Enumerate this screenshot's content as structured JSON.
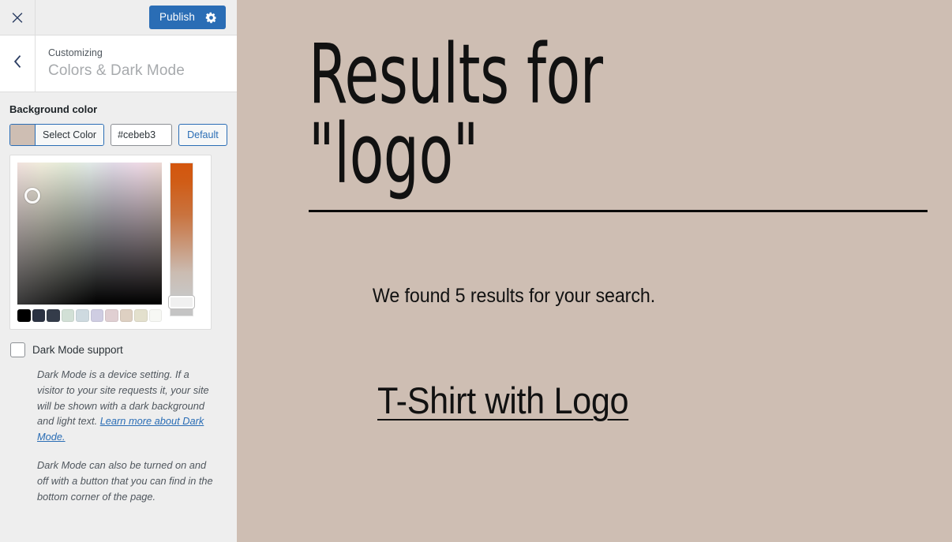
{
  "customizer": {
    "topbar": {
      "close_icon": "close-icon",
      "publish_label": "Publish",
      "settings_icon": "gear-icon"
    },
    "header": {
      "back_icon": "chevron-left-icon",
      "eyebrow": "Customizing",
      "title": "Colors & Dark Mode"
    },
    "background_color": {
      "label": "Background color",
      "select_color_label": "Select Color",
      "hex_value": "#cebeb3",
      "hex_placeholder": "Hex Value",
      "default_label": "Default",
      "current_color": "#cebeb3"
    },
    "picker": {
      "palette": [
        "#000000",
        "#2b3242",
        "#343c4a",
        "#d2e0d6",
        "#cedae0",
        "#cfcde2",
        "#e0cfd2",
        "#ded0c2",
        "#e3e0cd",
        "#f7f8f4"
      ]
    },
    "dark_mode": {
      "checkbox_label": "Dark Mode support",
      "checked": false,
      "help_text_1_before": "Dark Mode is a device setting. If a visitor to your site requests it, your site will be shown with a dark background and light text. ",
      "help_link_label": "Learn more about Dark Mode.",
      "help_text_2": "Dark Mode can also be turned on and off with a button that you can find in the bottom corner of the page."
    }
  },
  "preview": {
    "background_color": "#cebeb3",
    "search_heading": "Results for\n\"logo\"",
    "results_count_text": "We found 5 results for your search.",
    "result_title": "T-Shirt with Logo"
  }
}
